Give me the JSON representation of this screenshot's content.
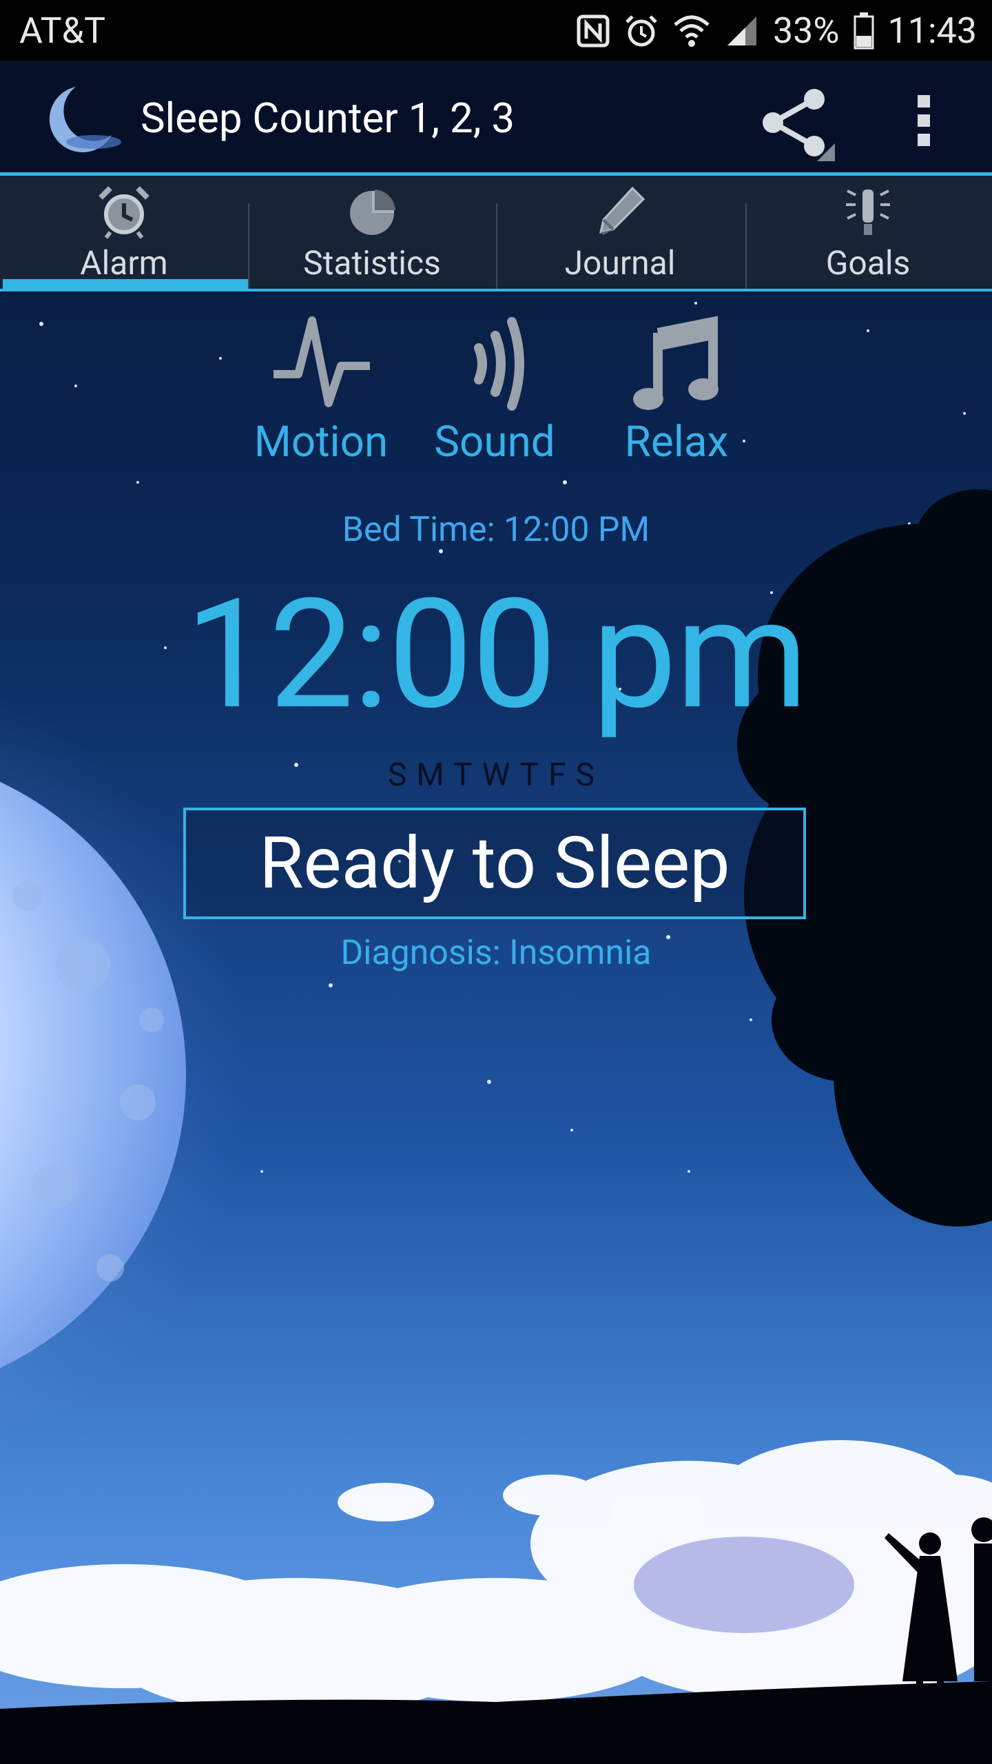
{
  "status_bar": {
    "carrier": "AT&T",
    "battery": "33%",
    "time": "11:43",
    "icons": [
      "nfc-icon",
      "alarm-icon",
      "wifi-icon",
      "signal-icon",
      "battery-icon"
    ]
  },
  "action_bar": {
    "title": "Sleep Counter 1, 2, 3",
    "icons": [
      "moon-logo-icon",
      "share-icon",
      "overflow-menu-icon"
    ]
  },
  "tabs": [
    {
      "label": "Alarm",
      "icon": "alarm-clock-icon",
      "active": true
    },
    {
      "label": "Statistics",
      "icon": "pie-chart-icon",
      "active": false
    },
    {
      "label": "Journal",
      "icon": "pencil-icon",
      "active": false
    },
    {
      "label": "Goals",
      "icon": "light-bulb-icon",
      "active": false
    }
  ],
  "modes": [
    {
      "label": "Motion",
      "icon": "pulse-icon"
    },
    {
      "label": "Sound",
      "icon": "sound-waves-icon"
    },
    {
      "label": "Relax",
      "icon": "music-note-icon"
    }
  ],
  "main": {
    "bed_time": "Bed Time: 12:00 PM",
    "alarm_time": "12:00 pm",
    "weekdays": "SMTWTFS",
    "ready_button": "Ready to Sleep",
    "diagnosis": "Diagnosis: Insomnia"
  },
  "colors": {
    "accent": "#33b5e5",
    "action_bar_bg": "#051028",
    "tab_bar_bg": "#172436",
    "sky_top": "#061634",
    "sky_bottom": "#3f7fd2"
  }
}
